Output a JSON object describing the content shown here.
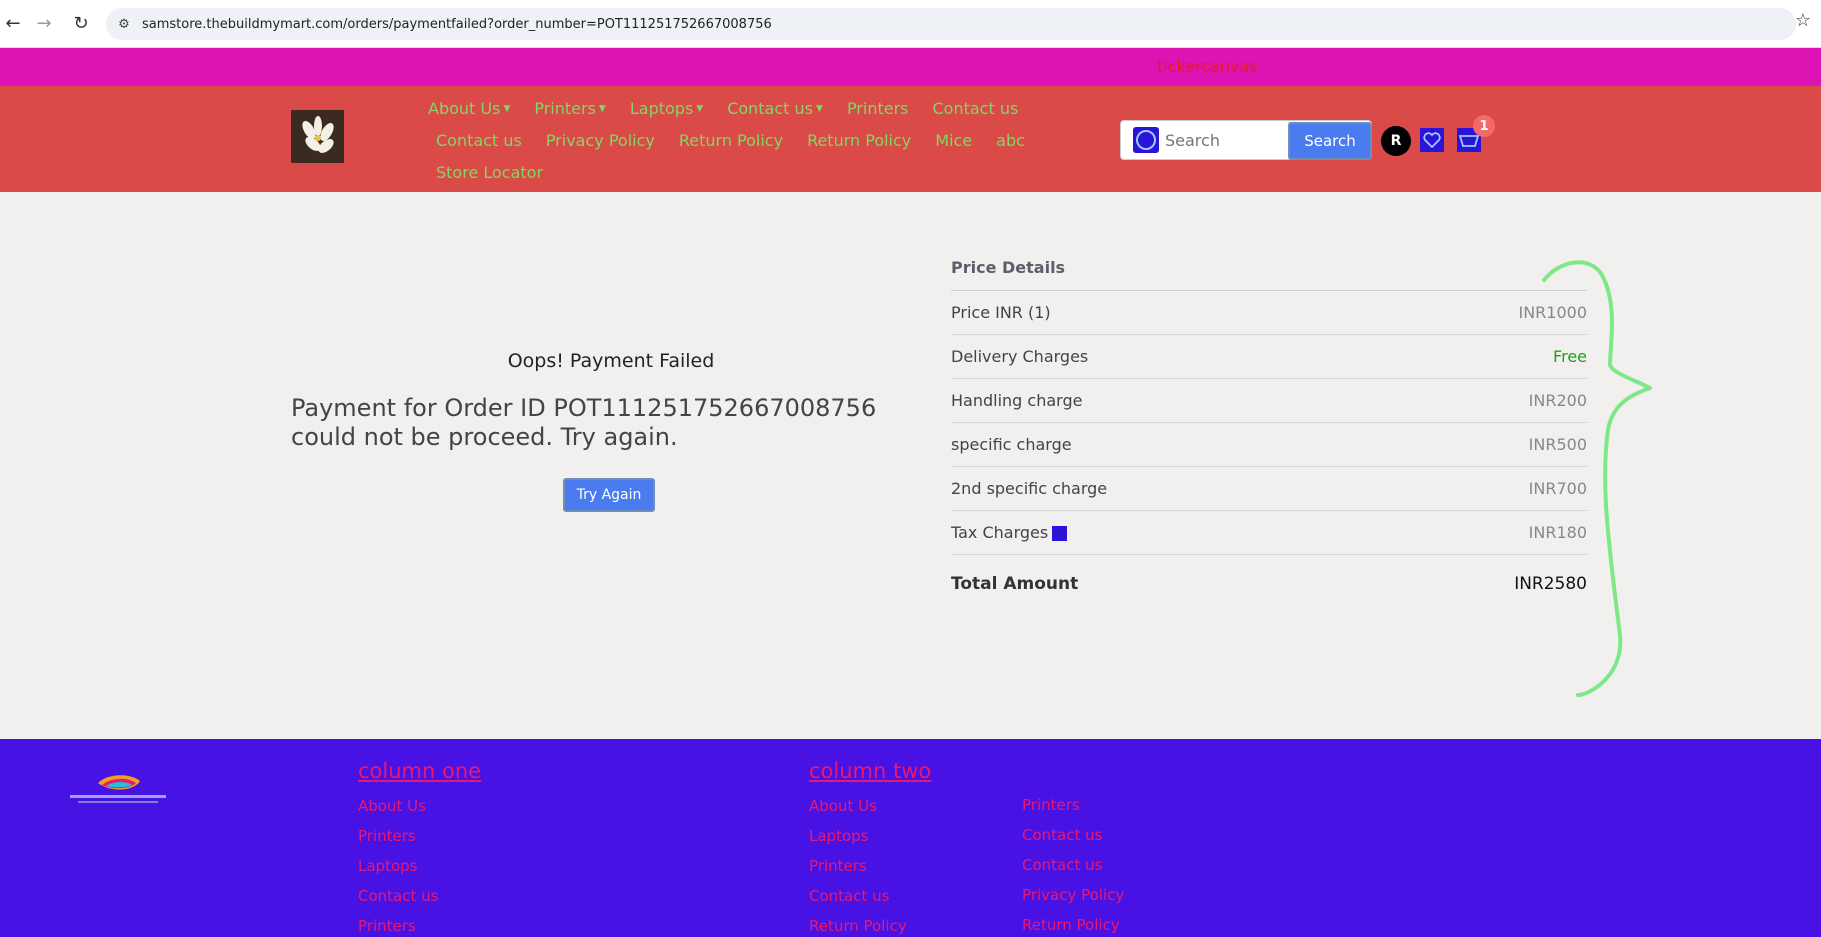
{
  "browser": {
    "url": "samstore.thebuildmymart.com/orders/paymentfailed?order_number=POT111251752667008756"
  },
  "ticker": {
    "text": "tickercanvas"
  },
  "header": {
    "menu_rows": [
      [
        {
          "label": "About Us",
          "dropdown": true
        },
        {
          "label": "Printers",
          "dropdown": true
        },
        {
          "label": "Laptops",
          "dropdown": true
        },
        {
          "label": "Contact us",
          "dropdown": true
        },
        {
          "label": "Printers",
          "dropdown": false
        },
        {
          "label": "Contact us",
          "dropdown": false
        }
      ],
      [
        {
          "label": "Contact us",
          "dropdown": false
        },
        {
          "label": "Privacy Policy",
          "dropdown": false
        },
        {
          "label": "Return Policy",
          "dropdown": false
        },
        {
          "label": "Return Policy",
          "dropdown": false
        },
        {
          "label": "Mice",
          "dropdown": false
        },
        {
          "label": "abc",
          "dropdown": false
        }
      ],
      [
        {
          "label": "Store Locator",
          "dropdown": false
        }
      ]
    ],
    "search_placeholder": "Search",
    "search_button": "Search",
    "avatar_letter": "R",
    "cart_count": "1"
  },
  "payment": {
    "title": "Oops! Payment Failed",
    "message": "Payment for Order ID POT111251752667008756 could not be proceed. Try again.",
    "try_again": "Try Again"
  },
  "price_details": {
    "title": "Price Details",
    "rows": [
      {
        "label": "Price INR (1)",
        "value": "INR1000"
      },
      {
        "label": "Delivery Charges",
        "value": "Free"
      },
      {
        "label": "Handling charge",
        "value": "INR200"
      },
      {
        "label": "specific charge",
        "value": "INR500"
      },
      {
        "label": "2nd specific charge",
        "value": "INR700"
      },
      {
        "label": "Tax Charges",
        "value": "INR180"
      }
    ],
    "total_label": "Total Amount",
    "total_value": "INR2580"
  },
  "footer": {
    "col1": {
      "title": "column one",
      "links": [
        "About Us",
        "Printers",
        "Laptops",
        "Contact us",
        "Printers"
      ]
    },
    "col2": {
      "title": "column two",
      "links": [
        "About Us",
        "Laptops",
        "Printers",
        "Contact us",
        "Return Policy"
      ]
    },
    "col3": {
      "links": [
        "Printers",
        "Contact us",
        "Contact us",
        "Privacy Policy",
        "Return Policy"
      ]
    }
  }
}
